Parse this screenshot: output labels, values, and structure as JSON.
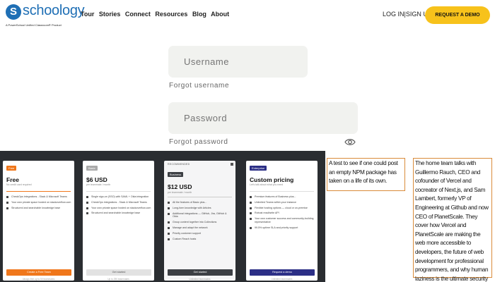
{
  "header": {
    "logo_mark": "S",
    "logo_word": "schoology",
    "logo_tagline": "A PowerSchool Unified Classroom® Product",
    "nav": [
      "Tour",
      "Stories",
      "Connect",
      "Resources",
      "Blog",
      "About"
    ],
    "login": "LOG IN",
    "separator": "|",
    "signup": "SIGN UP",
    "demo": "REQUEST A DEMO"
  },
  "login_form": {
    "username_placeholder": "Username",
    "forgot_username": "Forgot username",
    "password_placeholder": "Password",
    "forgot_password": "Forgot password"
  },
  "pricing": {
    "cards": [
      {
        "badge": "Free",
        "tier": "Free",
        "sub": "No credit card required",
        "features": [
          "CheckOps integrations - Slack & Microsoft Teams",
          "Your own private space hosted on stackoverflow.com",
          "Structured and searchable knowledge base"
        ],
        "cta": "Create a Free Team",
        "foot": "Always free up to 50 teammates"
      },
      {
        "badge": "Basic",
        "tier": "$6 USD",
        "sub": "per teammate / month",
        "features": [
          "Single sign-on (SSO) with SAML + Okta integration",
          "CheckOps integrations - Slack & Microsoft Teams",
          "Your own private space hosted on stackoverflow.com",
          "Structured and searchable knowledge base"
        ],
        "cta": "Get started",
        "foot": "Up to 250 teammates"
      },
      {
        "recommended": "RECOMMENDED",
        "badge": "Business",
        "tier": "$12 USD",
        "sub": "per teammate / month",
        "features": [
          "All the features of Basic plus...",
          "Long-form knowledge with Articles",
          "Additional integrations — GitHub, Jira, GitHub & Okta",
          "Group content together into Collections",
          "Manage and adapt the network",
          "Priority customer support",
          "Custom Reach hosts"
        ],
        "cta": "Get started",
        "foot": "Unlimited teammates"
      },
      {
        "badge": "Enterprise",
        "tier": "Custom pricing",
        "sub": "Let's talk about what you need",
        "features": [
          "Premium features of Business plus...",
          "Unlimited Teams within your instance",
          "Flexible hosting options — cloud or on-premise",
          "Robust read/write API",
          "Your own customer success and community-building representative",
          "99.5% uptime SLA and priority support"
        ],
        "cta": "Request a demo",
        "foot": "Unlimited teammates"
      }
    ]
  },
  "notes": {
    "a": "A test to see if one could post an empty NPM package has taken on a life of its own.",
    "b": "The home team talks with Guillermo Rauch, CEO and cofounder of Vercel and cocreator of Next.js, and Sam Lambert, formerly VP of Engineering at Github and now CEO of PlanetScale. They cover how Vercel and PlanetScale are making the web more accessible to developers, the future of web development for professional programmers, and why human laziness is the ultimate security threat."
  }
}
